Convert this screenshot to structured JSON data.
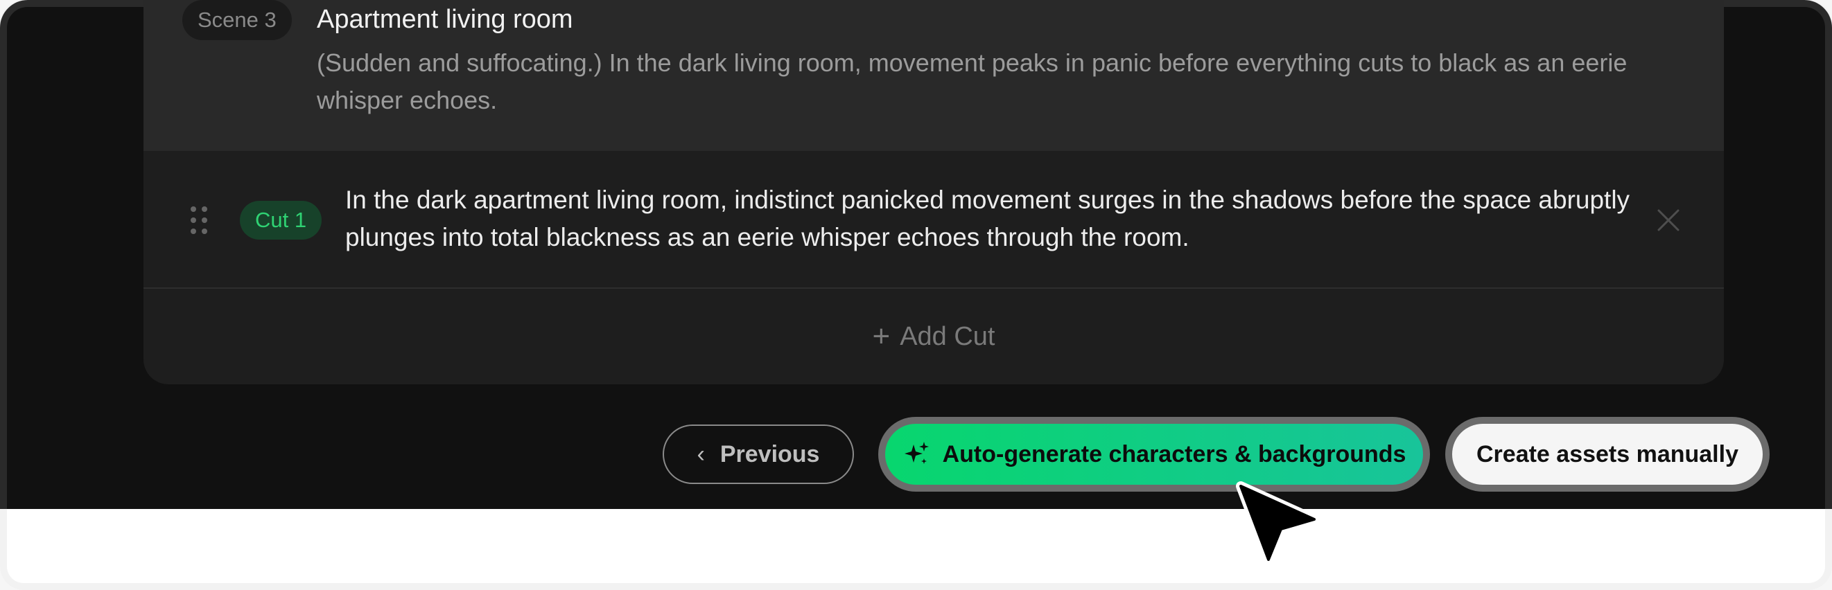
{
  "scene": {
    "badge": "Scene 3",
    "title": "Apartment living room",
    "description": "(Sudden and suffocating.) In the dark living room, movement peaks in panic before everything cuts to black as an eerie whisper echoes."
  },
  "cuts": [
    {
      "badge": "Cut 1",
      "text": "In the dark apartment living room, indistinct panicked movement surges in the shadows before the space abruptly plunges into total blackness as an eerie whisper echoes through the room."
    }
  ],
  "add_cut": {
    "icon": "plus-icon",
    "label": "Add Cut"
  },
  "footer": {
    "previous_label": "Previous",
    "auto_generate_label": "Auto-generate characters & backgrounds",
    "manual_label": "Create assets manually"
  },
  "colors": {
    "accent_green": "#08d66e",
    "accent_teal": "#18c49a",
    "cut_badge_text": "#2fd273",
    "cut_badge_bg": "#17422a"
  }
}
